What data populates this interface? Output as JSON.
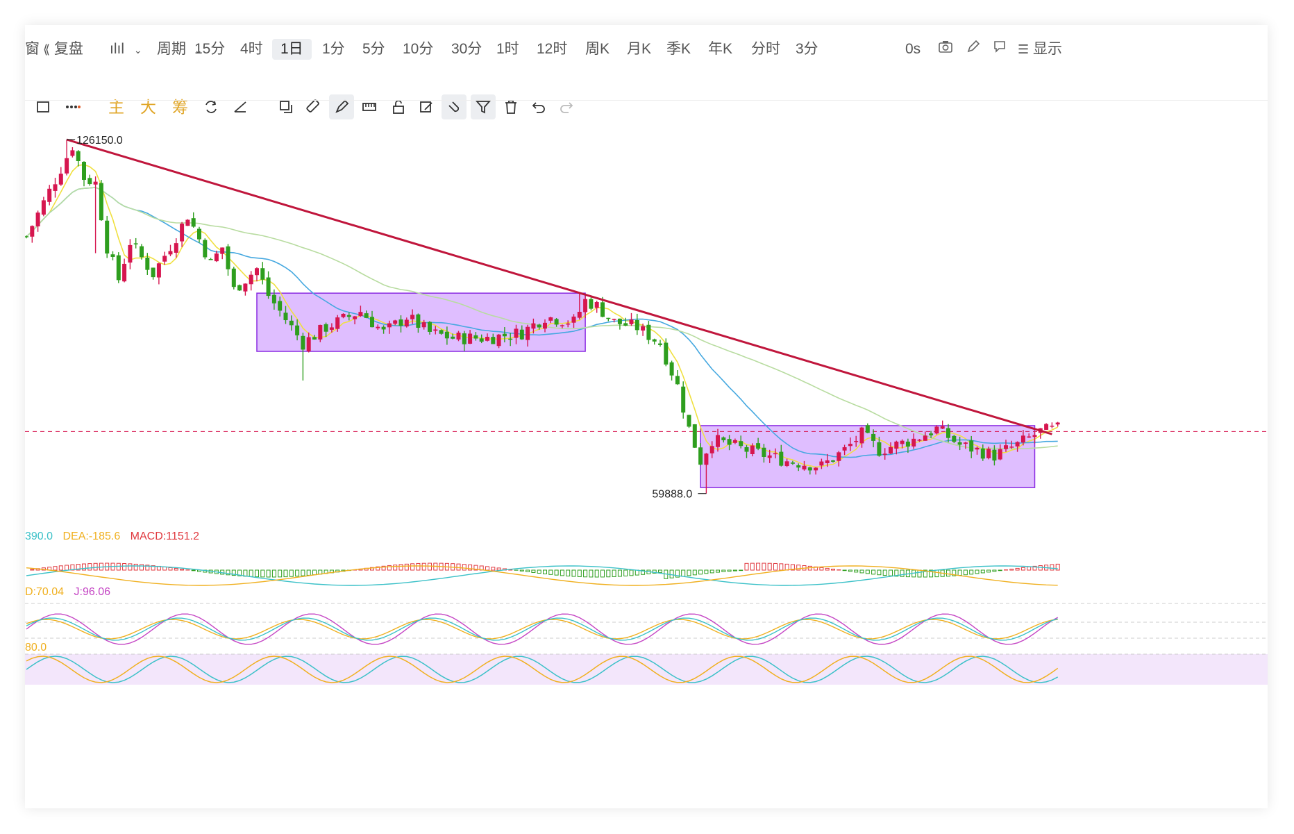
{
  "toolbar": {
    "window_label": "窗",
    "replay_label": "复盘",
    "period_label": "周期",
    "periods": [
      "15分",
      "4时",
      "1日",
      "1分",
      "5分",
      "10分",
      "30分",
      "1时",
      "12时",
      "周K",
      "月K",
      "季K",
      "年K",
      "分时",
      "3分"
    ],
    "active_period": "1日",
    "countdown": "0s",
    "display_label": "显示"
  },
  "draw_toolbar": {
    "main_label": "主",
    "big_label": "大",
    "chip_label": "筹"
  },
  "colors": {
    "up": "#d6164f",
    "down": "#2e9e1e",
    "trendline": "#c0163c",
    "box_fill": "#d9b3ff",
    "box_stroke": "#8a2be2",
    "ma_fast": "#f0e040",
    "ma_mid": "#45a8e0",
    "ma_slow": "#b8dca0",
    "dif": "#3cc1c8",
    "dea": "#f0b020",
    "macd": "#e0383e"
  },
  "chart_data": {
    "type": "candlestick",
    "price_high_label": "126150.0",
    "price_low_label": "59888.0",
    "ylim": [
      54000,
      132000
    ],
    "trend_line": {
      "from_index": 7,
      "from_price": 126150,
      "to_index": 178,
      "to_price": 71000
    },
    "boxes": [
      {
        "from_index": 40,
        "to_index": 97,
        "top": 97400,
        "bottom": 86500
      },
      {
        "from_index": 117,
        "to_index": 175,
        "top": 72600,
        "bottom": 61000
      }
    ],
    "reference_price": 71500,
    "macd": {
      "dif_label": "390.0",
      "dea_label": "DEA:-185.6",
      "macd_label": "MACD:1151.2"
    },
    "kdj": {
      "d_label": "D:70.04",
      "j_label": "J:96.06"
    },
    "third_label": "80.0"
  }
}
